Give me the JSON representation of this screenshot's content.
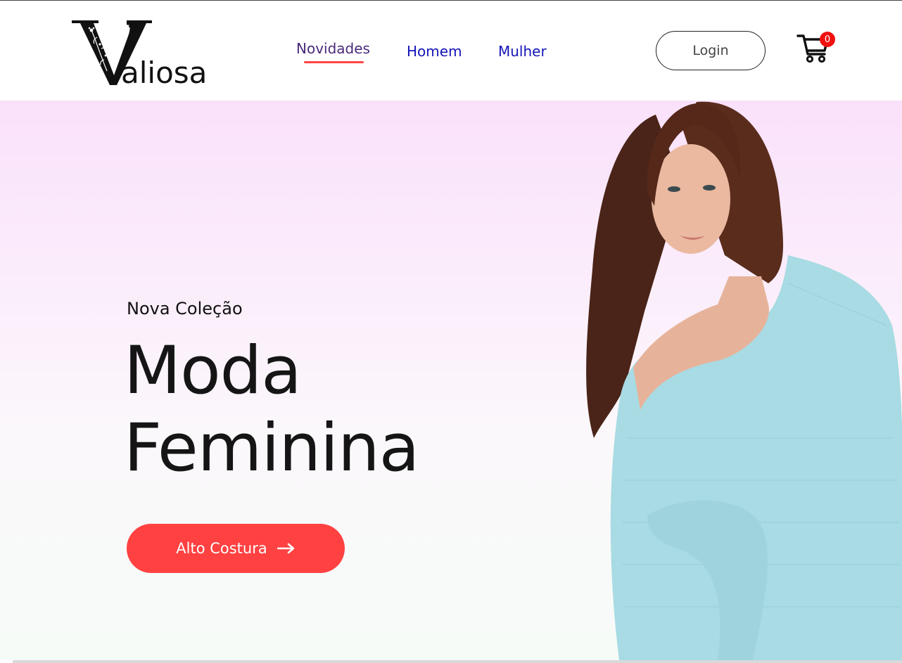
{
  "brand": {
    "logo_initial": "V",
    "logo_text": "aliosa"
  },
  "nav": {
    "items": [
      {
        "label": "Novidades",
        "active": true
      },
      {
        "label": "Homem",
        "active": false
      },
      {
        "label": "Mulher",
        "active": false
      }
    ]
  },
  "header": {
    "login_label": "Login",
    "cart_count": "0",
    "cart_icon": "shopping-cart-icon"
  },
  "hero": {
    "subtitle": "Nova Coleção",
    "headline_line1": "Moda",
    "headline_line2": "Feminina",
    "cta_label": "Alto Costura",
    "cta_icon": "arrow-right-icon",
    "image": "model-photo"
  },
  "colors": {
    "accent": "#ff4141",
    "nav_active": "#4a2a7a",
    "nav_link": "#1414b8",
    "badge": "#f01010",
    "hero_top": "#fae1fb",
    "hero_bottom": "#f6fbf8"
  }
}
